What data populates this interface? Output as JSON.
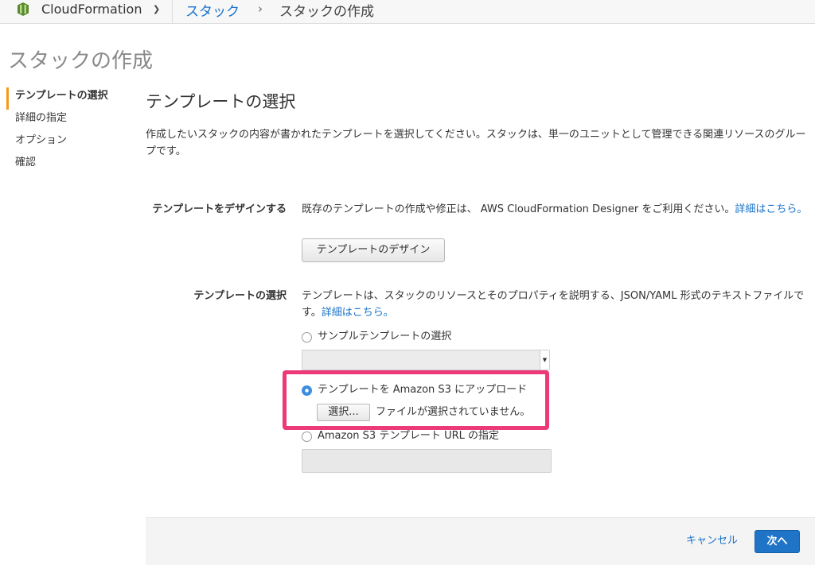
{
  "header": {
    "service_name": "CloudFormation",
    "service_icon": "cloudformation-logo-icon",
    "dropdown_icon": "chevron-down-icon",
    "breadcrumb": {
      "parent": "スタック",
      "separator": "›",
      "current": "スタックの作成"
    }
  },
  "page": {
    "title": "スタックの作成"
  },
  "wizard_steps": [
    {
      "label": "テンプレートの選択",
      "active": true
    },
    {
      "label": "詳細の指定",
      "active": false
    },
    {
      "label": "オプション",
      "active": false
    },
    {
      "label": "確認",
      "active": false
    }
  ],
  "main": {
    "section_title": "テンプレートの選択",
    "intro": "作成したいスタックの内容が書かれたテンプレートを選択してください。スタックは、単一のユニットとして管理できる関連リソースのグループです。",
    "design_row": {
      "label": "テンプレートをデザインする",
      "description": "既存のテンプレートの作成や修正は、 AWS CloudFormation Designer をご利用ください。",
      "link": "詳細はこちら。",
      "button": "テンプレートのデザイン"
    },
    "choose_row": {
      "label": "テンプレートの選択",
      "description": "テンプレートは、スタックのリソースとそのプロパティを説明する、JSON/YAML 形式のテキストファイルです。",
      "link": "詳細はこちら。",
      "options": {
        "sample": "サンプルテンプレートの選択",
        "upload": "テンプレートを Amazon S3 にアップロード",
        "url": "Amazon S3 テンプレート URL の指定"
      },
      "selected_option": "upload",
      "file_button": "選択...",
      "file_status": "ファイルが選択されていません。",
      "url_value": ""
    }
  },
  "footer": {
    "cancel": "キャンセル",
    "next": "次へ"
  },
  "colors": {
    "link": "#1a73c9",
    "primary_button": "#1f74c8",
    "active_step_bar": "#f7981c",
    "highlight_border": "#ec3a78",
    "logo": "#5a8a2e"
  }
}
